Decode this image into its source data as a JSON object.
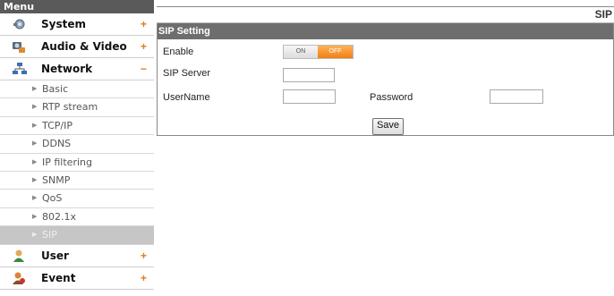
{
  "sidebar": {
    "title": "Menu",
    "groups": [
      {
        "label": "System",
        "toggle": "+"
      },
      {
        "label": "Audio & Video",
        "toggle": "+"
      },
      {
        "label": "Network",
        "toggle": "−"
      },
      {
        "label": "User",
        "toggle": "+"
      },
      {
        "label": "Event",
        "toggle": "+"
      }
    ],
    "network_items": [
      "Basic",
      "RTP stream",
      "TCP/IP",
      "DDNS",
      "IP filtering",
      "SNMP",
      "QoS",
      "802.1x",
      "SIP"
    ],
    "active_item": "SIP",
    "arrow_glyph": "▶"
  },
  "page": {
    "title": "SIP"
  },
  "sip_setting": {
    "header": "SIP Setting",
    "enable_label": "Enable",
    "toggle_on": "ON",
    "toggle_off": "OFF",
    "toggle_state": "OFF",
    "server_label": "SIP Server",
    "server_value": "",
    "username_label": "UserName",
    "username_value": "",
    "password_label": "Password",
    "password_value": "",
    "save_label": "Save"
  },
  "colors": {
    "accent_orange": "#f17f14",
    "header_gray": "#6e6e6e",
    "active_item_bg": "#c6c6c6"
  }
}
